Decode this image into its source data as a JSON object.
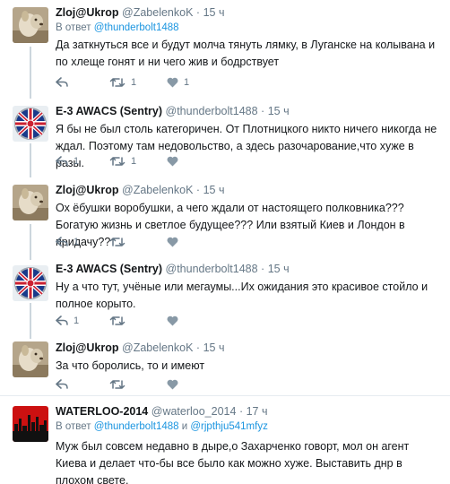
{
  "tweets": [
    {
      "name": "Zloj@Ukrop",
      "handle": "@ZabelenkoK",
      "dot": "·",
      "time": "15 ч",
      "reply_prefix": "В ответ ",
      "reply_to": "@thunderbolt1488",
      "text": "Да заткнуться все и будут молча тянуть лямку, в Луганске на колывана и по хлеще гонят и ни чего жив и бодрствует",
      "reply_count": "",
      "retweet_count": "1",
      "like_count": "1"
    },
    {
      "name": "E-3 AWACS (Sentry)",
      "handle": "@thunderbolt1488",
      "dot": "·",
      "time": "15 ч",
      "text": "Я бы не был столь категоричен. От Плотницкого никто ничего никогда не ждал. Поэтому там недовольство, а здесь разочарование,что хуже в разы.",
      "reply_count": "1",
      "retweet_count": "1",
      "like_count": ""
    },
    {
      "name": "Zloj@Ukrop",
      "handle": "@ZabelenkoK",
      "dot": "·",
      "time": "15 ч",
      "text": "Ох ёбушки воробушки,  а чего ждали от настоящего полковника??? Богатую жизнь и светлое будущее??? Или взятый Киев и Лондон в придачу??",
      "reply_count": "1",
      "retweet_count": "",
      "like_count": ""
    },
    {
      "name": "E-3 AWACS (Sentry)",
      "handle": "@thunderbolt1488",
      "dot": "·",
      "time": "15 ч",
      "text": "Ну а что тут, учёные или мегаумы...Их ожидания это красивое стойло и полное корыто.",
      "reply_count": "1",
      "retweet_count": "",
      "like_count": ""
    },
    {
      "name": "Zloj@Ukrop",
      "handle": "@ZabelenkoK",
      "dot": "·",
      "time": "15 ч",
      "text": "За что боролись, то и имеют",
      "reply_count": "",
      "retweet_count": "",
      "like_count": ""
    },
    {
      "name": "WATERLOO-2014",
      "handle": "@waterloo_2014",
      "dot": "·",
      "time": "17 ч",
      "reply_prefix": "В ответ ",
      "reply_to": "@thunderbolt1488",
      "reply_joiner": " и ",
      "reply_to_2": "@rjpthju541mfyz",
      "text": "Муж был совсем недавно в дыре,о Захарченко говорт, мол он агент Киева и делает что-бы все было как можно хуже. Выставить днр в плохом свете."
    }
  ],
  "colors": {
    "link": "#1b95e0",
    "muted": "#657786",
    "thread_line": "#ccd6dd"
  }
}
